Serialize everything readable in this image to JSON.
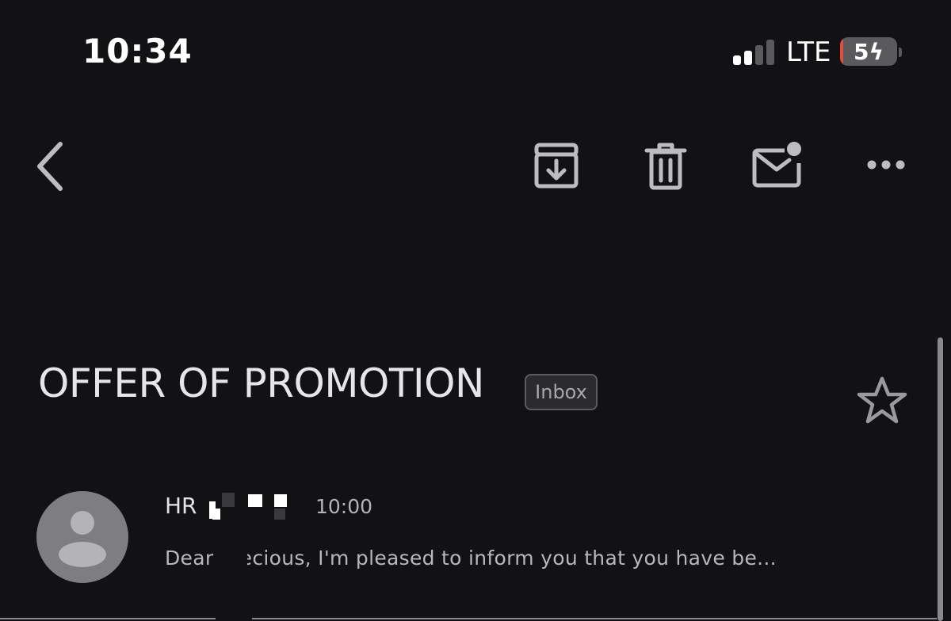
{
  "status_bar": {
    "time": "10:34",
    "network": "LTE",
    "battery": "5",
    "battery_level_percent": 5,
    "signal_bars_active": 2,
    "signal_bars_total": 4
  },
  "toolbar": {
    "back_icon": "chevron-left-icon",
    "archive_icon": "archive-icon",
    "delete_icon": "trash-icon",
    "mark_unread_icon": "mail-unread-icon",
    "more_icon": "more-horizontal-icon"
  },
  "message": {
    "subject": "OFFER OF PROMOTION",
    "label": "Inbox",
    "starred": false,
    "sender": "HR",
    "time": "10:00",
    "snippet": "Dear    Precious, I'm pleased to inform you that you have be..."
  },
  "colors": {
    "background": "#121113",
    "text": "#e6e6e8",
    "icon": "#bdbdc0",
    "avatar": "#7d7d82",
    "battery_low": "#e24b3f"
  }
}
